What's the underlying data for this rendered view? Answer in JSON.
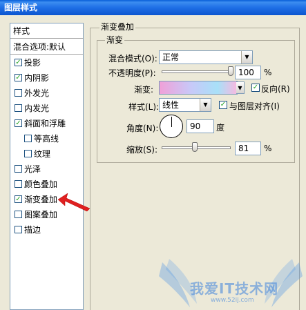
{
  "window": {
    "title": "图层样式"
  },
  "styles_list": {
    "header": "样式",
    "blend_options": "混合选项:默认",
    "items": [
      {
        "label": "投影",
        "checked": true
      },
      {
        "label": "内阴影",
        "checked": true
      },
      {
        "label": "外发光",
        "checked": false
      },
      {
        "label": "内发光",
        "checked": false
      },
      {
        "label": "斜面和浮雕",
        "checked": true
      },
      {
        "label": "等高线",
        "checked": false
      },
      {
        "label": "纹理",
        "checked": false
      },
      {
        "label": "光泽",
        "checked": false
      },
      {
        "label": "颜色叠加",
        "checked": false
      },
      {
        "label": "渐变叠加",
        "checked": true,
        "selected": true
      },
      {
        "label": "图案叠加",
        "checked": false
      },
      {
        "label": "描边",
        "checked": false
      }
    ]
  },
  "panel": {
    "group_title": "渐变叠加",
    "sub_group_title": "渐变",
    "blend_mode_label": "混合模式(O):",
    "blend_mode_value": "正常",
    "opacity_label": "不透明度(P):",
    "opacity_value": "100",
    "opacity_unit": "%",
    "opacity_level": 100,
    "gradient_label": "渐变:",
    "reverse_label": "反向(R)",
    "reverse_checked": true,
    "style_label": "样式(L):",
    "style_value": "线性",
    "align_label": "与图层对齐(I)",
    "align_checked": true,
    "angle_label": "角度(N):",
    "angle_value": "90",
    "angle_unit": "度",
    "scale_label": "缩放(S):",
    "scale_value": "81",
    "scale_unit": "%",
    "scale_level": 81
  },
  "watermark": {
    "text": "我爱IT技术网",
    "url": "www.52ij.com"
  },
  "colors": {
    "accent_arrow": "#e02020",
    "selection": "#316ac5",
    "titlebar": "#1f6fe6"
  }
}
